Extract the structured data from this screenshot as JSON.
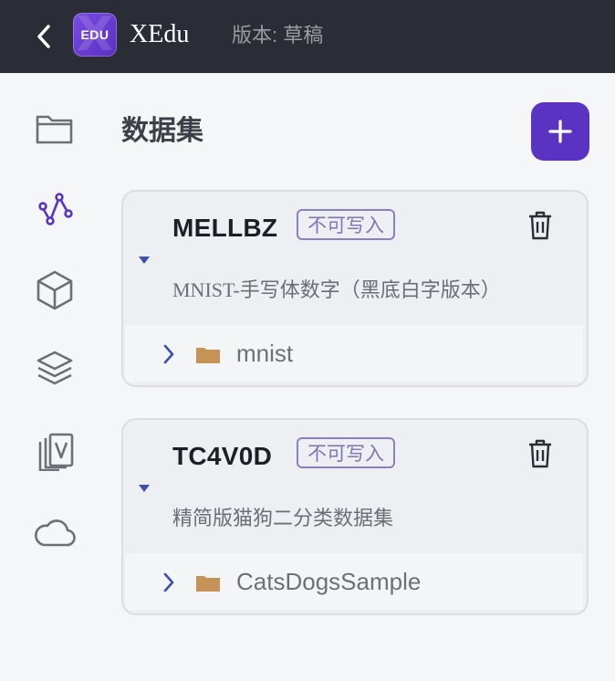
{
  "header": {
    "logo_text": "EDU",
    "app_name": "XEdu",
    "version": "版本: 草稿"
  },
  "sidebar": {
    "items": [
      {
        "icon": "folder-icon"
      },
      {
        "icon": "graph-nodes-icon",
        "active": true
      },
      {
        "icon": "cube-icon"
      },
      {
        "icon": "layers-icon"
      },
      {
        "icon": "video-cards-icon"
      },
      {
        "icon": "cloud-icon"
      }
    ]
  },
  "main": {
    "title": "数据集",
    "datasets": [
      {
        "name": "MELLBZ",
        "badge": "不可写入",
        "description": "MNIST-手写体数字（黑底白字版本）",
        "folder": "mnist"
      },
      {
        "name": "TC4V0D",
        "badge": "不可写入",
        "description": "精简版猫狗二分类数据集",
        "folder": "CatsDogsSample"
      }
    ]
  },
  "colors": {
    "topbar": "#2a2d36",
    "accent": "#5a33c2",
    "badge": "#8a80c2",
    "folder": "#c69255"
  }
}
